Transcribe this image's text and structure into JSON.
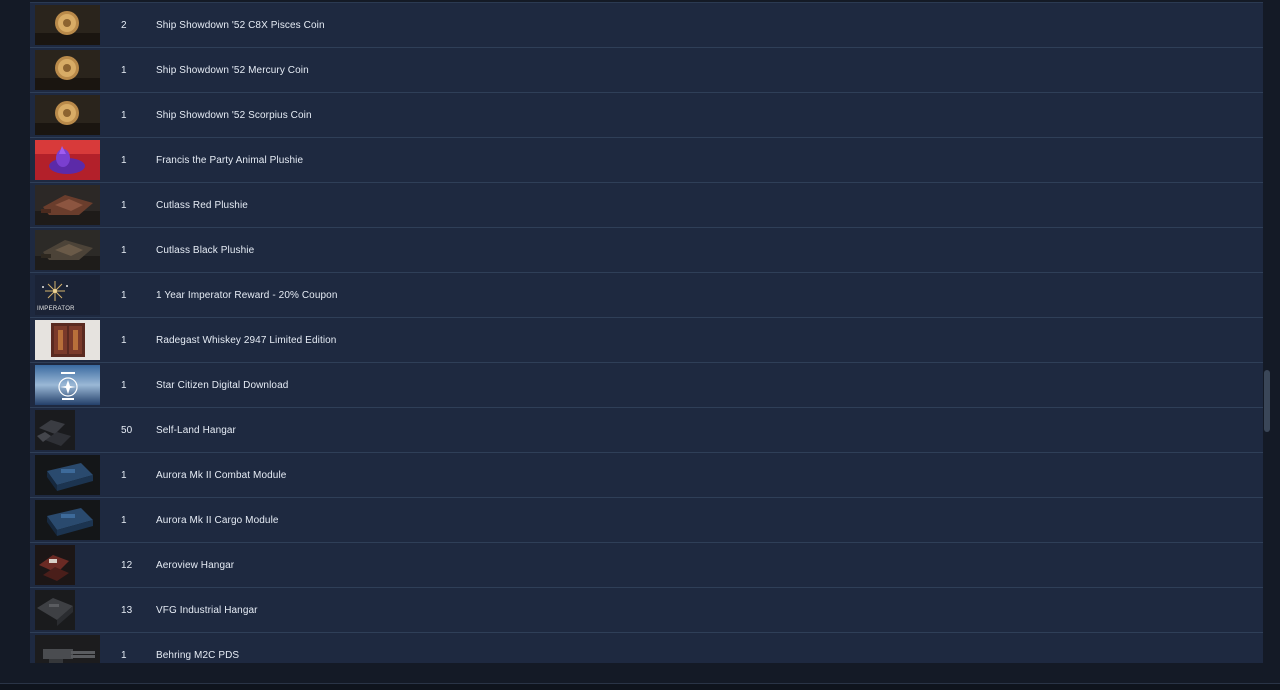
{
  "items": [
    {
      "qty": "2",
      "name": "Ship Showdown '52 C8X Pisces Coin",
      "icon": "coin-icon"
    },
    {
      "qty": "1",
      "name": "Ship Showdown '52 Mercury Coin",
      "icon": "coin-icon"
    },
    {
      "qty": "1",
      "name": "Ship Showdown '52 Scorpius Coin",
      "icon": "coin-icon"
    },
    {
      "qty": "1",
      "name": "Francis the Party Animal Plushie",
      "icon": "plushie-icon"
    },
    {
      "qty": "1",
      "name": "Cutlass Red Plushie",
      "icon": "ship-plushie-icon"
    },
    {
      "qty": "1",
      "name": "Cutlass Black Plushie",
      "icon": "ship-plushie-icon"
    },
    {
      "qty": "1",
      "name": "1 Year Imperator Reward - 20% Coupon",
      "icon": "imperator-logo-icon",
      "logo_text": "IMPERATOR"
    },
    {
      "qty": "1",
      "name": "Radegast Whiskey 2947 Limited Edition",
      "icon": "whiskey-case-icon"
    },
    {
      "qty": "1",
      "name": "Star Citizen Digital Download",
      "icon": "star-citizen-logo-icon"
    },
    {
      "qty": "50",
      "name": "Self-Land Hangar",
      "icon": "hangar-icon"
    },
    {
      "qty": "1",
      "name": "Aurora Mk II Combat Module",
      "icon": "module-icon"
    },
    {
      "qty": "1",
      "name": "Aurora Mk II Cargo Module",
      "icon": "module-icon"
    },
    {
      "qty": "12",
      "name": "Aeroview Hangar",
      "icon": "hangar-icon"
    },
    {
      "qty": "13",
      "name": "VFG Industrial Hangar",
      "icon": "hangar-icon"
    },
    {
      "qty": "1",
      "name": "Behring M2C PDS",
      "icon": "turret-icon"
    }
  ],
  "colors": {
    "background": "#141a26",
    "row_background": "#1e2940",
    "row_divider": "#2f3f58",
    "text": "#e6ecf5"
  }
}
